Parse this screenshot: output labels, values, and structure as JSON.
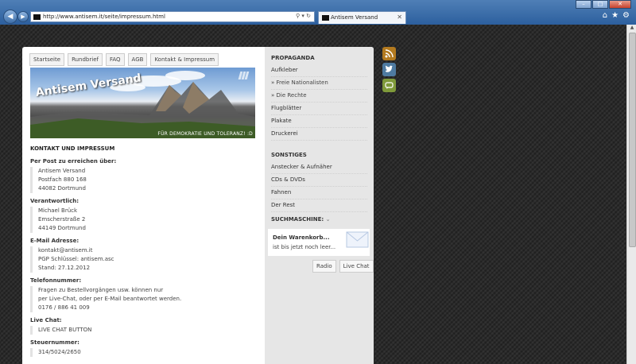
{
  "browser": {
    "url": "http://www.antisem.it/seite/impressum.html",
    "tab_title": "Antisem Versand"
  },
  "topnav": [
    "Startseite",
    "Rundbrief",
    "FAQ",
    "AGB",
    "Kontakt & Impressum"
  ],
  "banner": {
    "brand": "Antisem Versand",
    "tagline": "FÜR DEMOKRATIE UND TOLERANZ! :D"
  },
  "content": {
    "heading": "KONTAKT UND IMPRESSUM",
    "sections": [
      {
        "label": "Per Post zu erreichen über:",
        "lines": [
          "Antisem Versand",
          "Postfach 880 168",
          "44082 Dortmund"
        ]
      },
      {
        "label": "Verantwortlich:",
        "lines": [
          "Michael Brück",
          "Emscherstraße 2",
          "44149 Dortmund"
        ]
      },
      {
        "label": "E-Mail Adresse:",
        "lines": [
          "kontakt@antisem.it",
          "PGP Schlüssel: antisem.asc",
          "Stand: 27.12.2012"
        ]
      },
      {
        "label": "Telefonnummer:",
        "lines": [
          "Fragen zu Bestellvorgängen usw. können nur",
          "per Live-Chat, oder per E-Mail beantwortet werden.",
          "0176 / 886 41 009"
        ]
      },
      {
        "label": "Live Chat:",
        "lines": [
          "LIVE CHAT BUTTON"
        ]
      },
      {
        "label": "Steuernummer:",
        "lines": [
          "314/5024/2650"
        ]
      }
    ]
  },
  "sidebar": {
    "propaganda_heading": "PROPAGANDA",
    "propaganda": [
      "Aufkleber",
      "» Freie Nationalisten",
      "» Die Rechte",
      "Flugblätter",
      "Plakate",
      "Druckerei"
    ],
    "sonstiges_heading": "SONSTIGES",
    "sonstiges": [
      "Anstecker & Aufnäher",
      "CDs & DVDs",
      "Fahnen",
      "Der Rest"
    ],
    "search_heading": "SUCHMASCHINE:",
    "cart_title": "Dein Warenkorb...",
    "cart_status": "ist bis jetzt noch leer...",
    "buttons": [
      "Radio",
      "Live Chat"
    ]
  },
  "icons": {
    "rss": "rss-icon",
    "twitter": "twitter-icon",
    "chat": "chat-icon"
  }
}
